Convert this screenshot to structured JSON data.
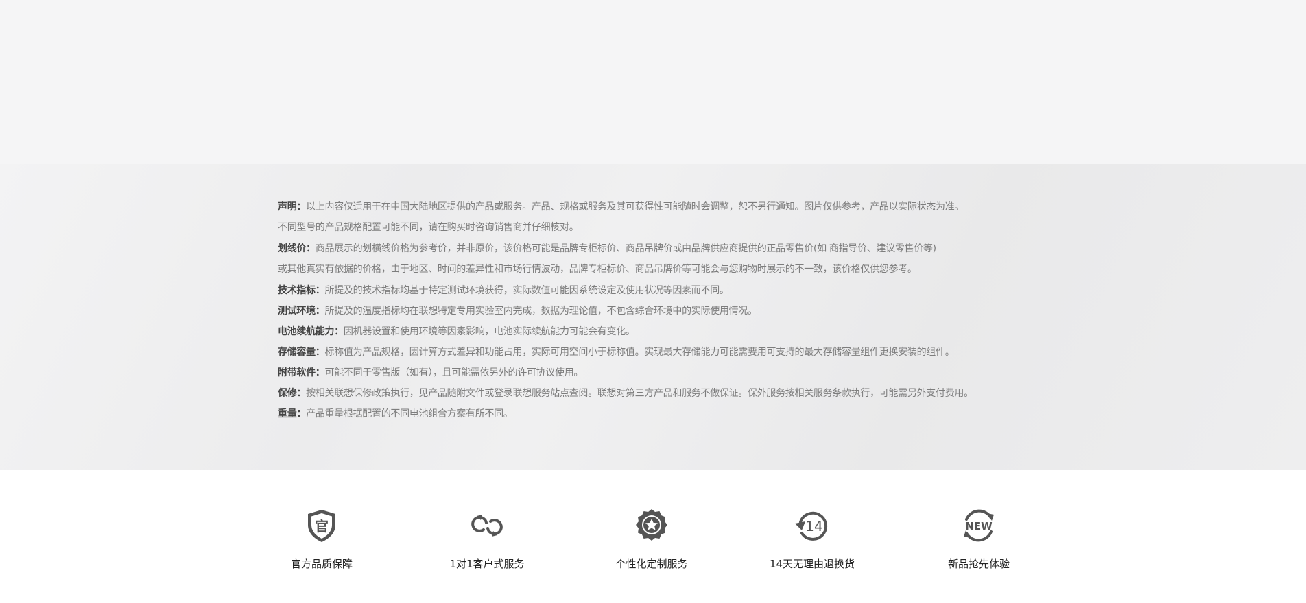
{
  "disclaimer": {
    "statement_key": "声明：",
    "statement_text": "以上内容仅适用于在中国大陆地区提供的产品或服务。产品、规格或服务及其可获得性可能随时会调整，恕不另行通知。图片仅供参考，产品以实际状态为准。",
    "statement_text_2": "不同型号的产品规格配置可能不同，请在购买时咨询销售商并仔细核对。",
    "strike_key": "划线价：",
    "strike_text": "商品展示的划横线价格为参考价，并非原价，该价格可能是品牌专柜标价、商品吊牌价或由品牌供应商提供的正品零售价(如 商指导价、建议零售价等)",
    "strike_text_2": "或其他真实有依据的价格，由于地区、时间的差异性和市场行情波动，品牌专柜标价、商品吊牌价等可能会与您购物时展示的不一致，该价格仅供您参考。",
    "tech_key": "技术指标：",
    "tech_text": "所提及的技术指标均基于特定测试环境获得，实际数值可能因系统设定及使用状况等因素而不同。",
    "env_key": "测试环境：",
    "env_text": "所提及的温度指标均在联想特定专用实验室内完成，数据为理论值，不包含综合环境中的实际使用情况。",
    "battery_key": "电池续航能力：",
    "battery_text": "因机器设置和使用环境等因素影响，电池实际续航能力可能会有变化。",
    "storage_key": "存储容量：",
    "storage_text": "标称值为产品规格，因计算方式差异和功能占用，实际可用空间小于标称值。实现最大存储能力可能需要用可支持的最大存储容量组件更换安装的组件。",
    "software_key": "附带软件：",
    "software_text": "可能不同于零售版（如有），且可能需依另外的许可协议使用。",
    "warranty_key": "保修：",
    "warranty_text": "按相关联想保修政策执行，见产品随附文件或登录联想服务站点查阅。联想对第三方产品和服务不做保证。保外服务按相关服务条款执行，可能需另外支付费用。",
    "weight_key": "重量：",
    "weight_text": "产品重量根据配置的不同电池组合方案有所不同。"
  },
  "services": [
    {
      "label": "官方品质保障",
      "icon": "official-shield-icon",
      "icon_text": "官"
    },
    {
      "label": "1对1客户式服务",
      "icon": "one-to-one-link-icon"
    },
    {
      "label": "个性化定制服务",
      "icon": "star-badge-icon"
    },
    {
      "label": "14天无理由退换货",
      "icon": "return-14-days-icon",
      "icon_text": "14"
    },
    {
      "label": "新品抢先体验",
      "icon": "new-product-icon",
      "icon_text": "NEW"
    }
  ],
  "colors": {
    "icon": "#555555",
    "key_text": "#444444",
    "body_text": "#7d7d7d",
    "label_text": "#222222"
  }
}
